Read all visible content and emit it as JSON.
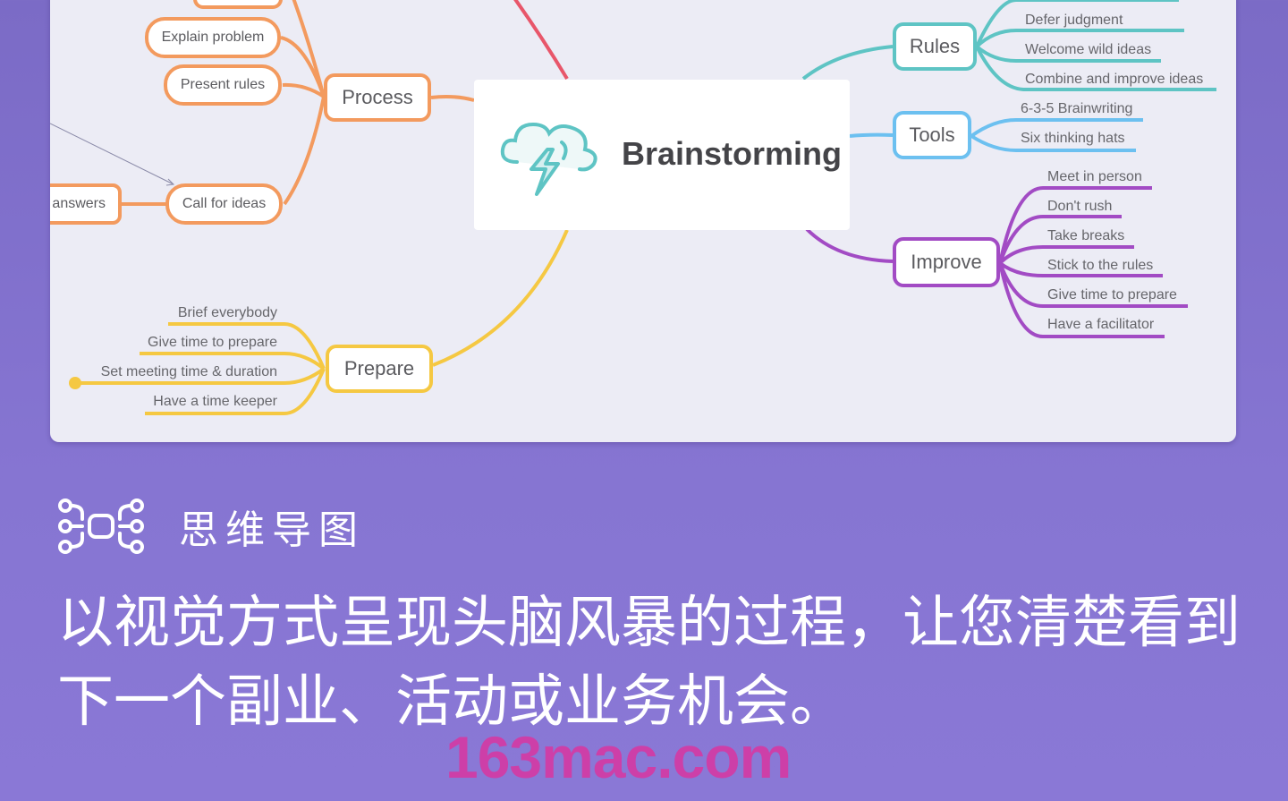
{
  "mindmap": {
    "central_topic": "Brainstorming",
    "central_icon": "storm-cloud-icon",
    "colors": {
      "process": "#f39a5e",
      "rules": "#5ec4c4",
      "tools": "#6cc0f0",
      "improve": "#a24bc4",
      "prepare": "#f5c842",
      "hidden_branch": "#e8566a"
    },
    "branches": {
      "process": {
        "label": "Process",
        "children": [
          "Explain problem",
          "Present rules",
          "Call for ideas"
        ],
        "linked_node": "answers"
      },
      "rules": {
        "label": "Rules",
        "children": [
          "Defer judgment",
          "Welcome wild ideas",
          "Combine and improve ideas"
        ]
      },
      "tools": {
        "label": "Tools",
        "children": [
          "6-3-5 Brainwriting",
          "Six thinking hats"
        ]
      },
      "improve": {
        "label": "Improve",
        "children": [
          "Meet in person",
          "Don't rush",
          "Take breaks",
          "Stick to the rules",
          "Give time to prepare",
          "Have a facilitator"
        ]
      },
      "prepare": {
        "label": "Prepare",
        "children": [
          "Brief everybody",
          "Give time to prepare",
          "Set meeting time & duration",
          "Have a time keeper"
        ]
      }
    }
  },
  "feature": {
    "icon": "mind-map-icon",
    "title": "思维导图",
    "description": "以视觉方式呈现头脑风暴的过程，让您清楚看到下一个副业、活动或业务机会。"
  },
  "watermark": "163mac.com"
}
